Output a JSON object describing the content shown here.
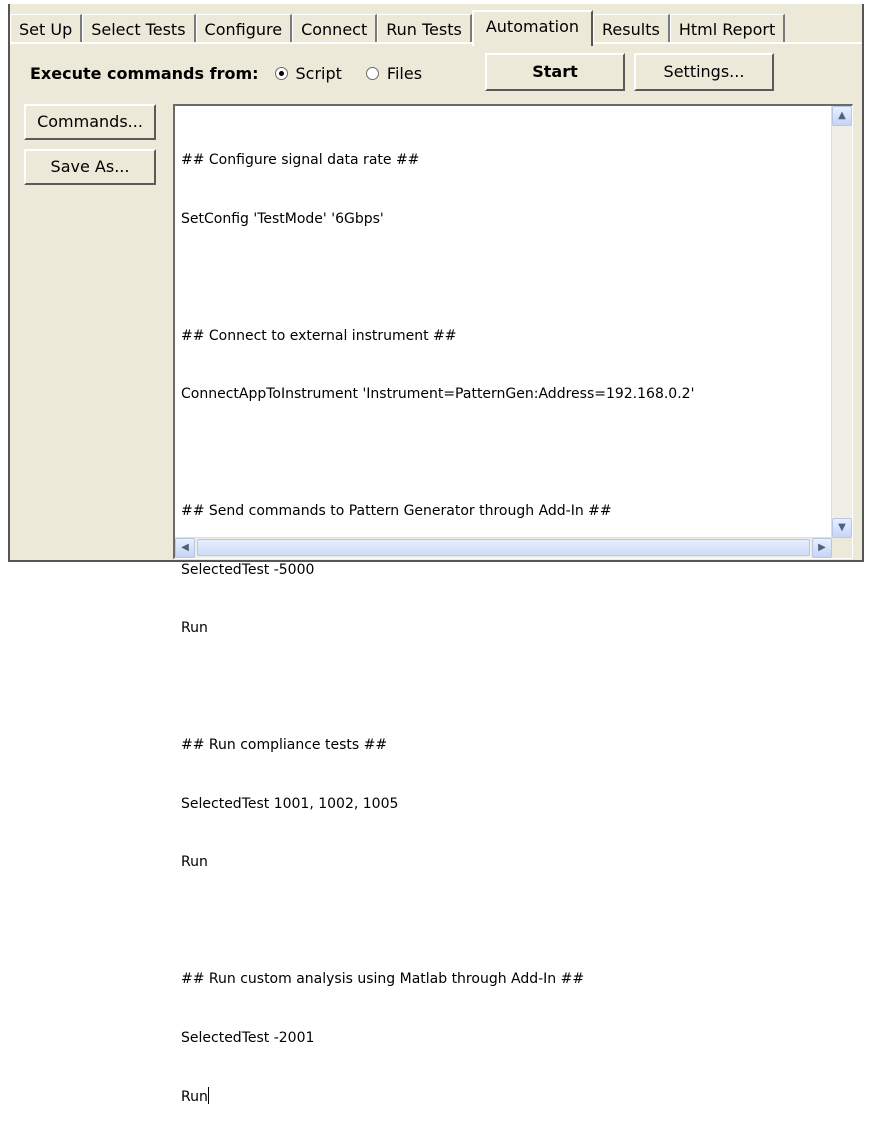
{
  "tabs": [
    "Set Up",
    "Select Tests",
    "Configure",
    "Connect",
    "Run Tests",
    "Automation",
    "Results",
    "Html Report"
  ],
  "active_tab": "Automation",
  "execute": {
    "label": "Execute commands from:",
    "options": [
      {
        "label": "Script",
        "selected": true
      },
      {
        "label": "Files",
        "selected": false
      }
    ]
  },
  "buttons": {
    "start": "Start",
    "settings": "Settings...",
    "commands": "Commands...",
    "save_as": "Save As..."
  },
  "script_lines": [
    "## Configure signal data rate ##",
    "SetConfig 'TestMode' '6Gbps'",
    "",
    "## Connect to external instrument ##",
    "ConnectAppToInstrument 'Instrument=PatternGen:Address=192.168.0.2'",
    "",
    "## Send commands to Pattern Generator through Add-In ##",
    "SelectedTest -5000",
    "Run",
    "",
    "## Run compliance tests ##",
    "SelectedTest 1001, 1002, 1005",
    "Run",
    "",
    "## Run custom analysis using Matlab through Add-In ##",
    "SelectedTest -2001",
    "Run"
  ],
  "icons": {
    "scroll_up": "chevron-up-icon",
    "scroll_down": "chevron-down-icon",
    "scroll_left": "chevron-left-icon",
    "scroll_right": "chevron-right-icon"
  }
}
